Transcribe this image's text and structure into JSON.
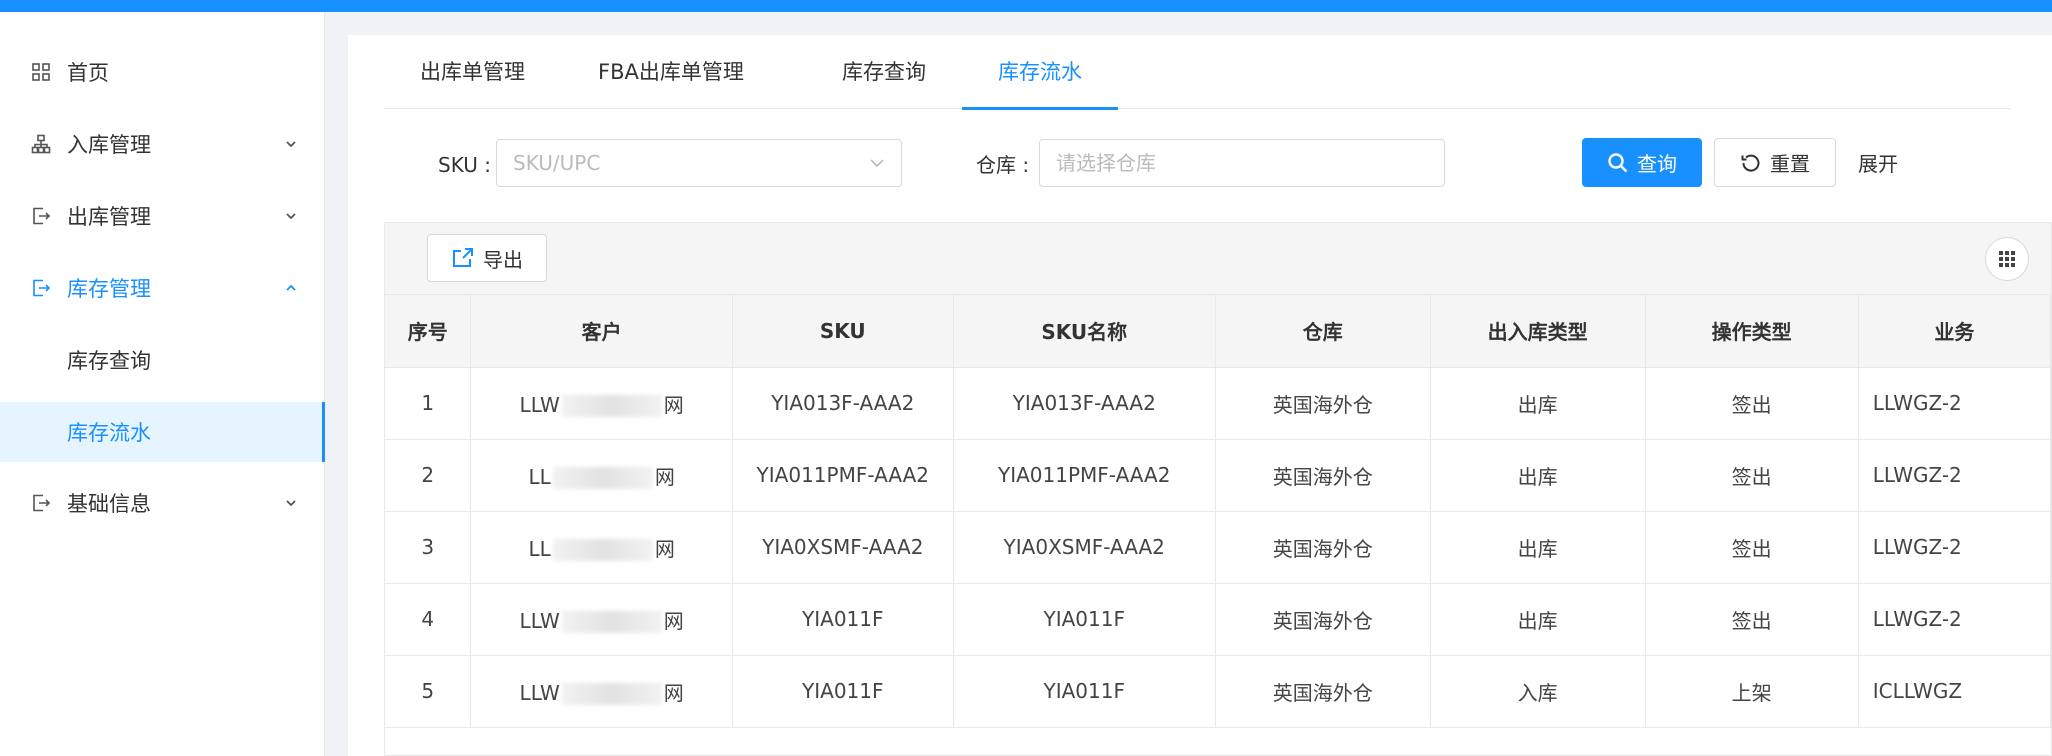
{
  "sidebar": {
    "items": [
      {
        "label": "首页",
        "icon": "grid-icon",
        "expandable": false
      },
      {
        "label": "入库管理",
        "icon": "sitemap-icon",
        "expandable": true
      },
      {
        "label": "出库管理",
        "icon": "logout-icon",
        "expandable": true
      },
      {
        "label": "库存管理",
        "icon": "logout-icon",
        "expandable": true,
        "expanded": true,
        "active": true
      },
      {
        "label": "基础信息",
        "icon": "logout-icon",
        "expandable": true
      }
    ],
    "submenu": [
      {
        "label": "库存查询",
        "selected": false
      },
      {
        "label": "库存流水",
        "selected": true
      }
    ]
  },
  "tabs": [
    {
      "label": "出库单管理"
    },
    {
      "label": "FBA出库单管理"
    },
    {
      "label": "库存查询"
    },
    {
      "label": "库存流水",
      "active": true
    }
  ],
  "filters": {
    "sku_label": "SKU :",
    "sku_placeholder": "SKU/UPC",
    "warehouse_label": "仓库 :",
    "warehouse_placeholder": "请选择仓库"
  },
  "buttons": {
    "search": "查询",
    "reset": "重置",
    "expand": "展开",
    "export": "导出"
  },
  "table": {
    "columns": [
      "序号",
      "客户",
      "SKU",
      "SKU名称",
      "仓库",
      "出入库类型",
      "操作类型",
      "业务"
    ],
    "rows": [
      {
        "no": "1",
        "customer_start": "LLW",
        "customer_end": "网",
        "sku": "YIA013F-AAA2",
        "sku_name": "YIA013F-AAA2",
        "warehouse": "英国海外仓",
        "io_type": "出库",
        "op_type": "签出",
        "biz": "LLWGZ-2"
      },
      {
        "no": "2",
        "customer_start": "LL",
        "customer_end": "网",
        "sku": "YIA011PMF-AAA2",
        "sku_name": "YIA011PMF-AAA2",
        "warehouse": "英国海外仓",
        "io_type": "出库",
        "op_type": "签出",
        "biz": "LLWGZ-2"
      },
      {
        "no": "3",
        "customer_start": "LL",
        "customer_end": "网",
        "sku": "YIA0XSMF-AAA2",
        "sku_name": "YIA0XSMF-AAA2",
        "warehouse": "英国海外仓",
        "io_type": "出库",
        "op_type": "签出",
        "biz": "LLWGZ-2"
      },
      {
        "no": "4",
        "customer_start": "LLW",
        "customer_end": "网",
        "sku": "YIA011F",
        "sku_name": "YIA011F",
        "warehouse": "英国海外仓",
        "io_type": "出库",
        "op_type": "签出",
        "biz": "LLWGZ-2"
      },
      {
        "no": "5",
        "customer_start": "LLW",
        "customer_end": "网",
        "sku": "YIA011F",
        "sku_name": "YIA011F",
        "warehouse": "英国海外仓",
        "io_type": "入库",
        "op_type": "上架",
        "biz": "ICLLWGZ"
      }
    ]
  },
  "colors": {
    "primary": "#1890ff",
    "selected_bg": "#e6f4ff",
    "header_bg": "#f5f5f5"
  }
}
